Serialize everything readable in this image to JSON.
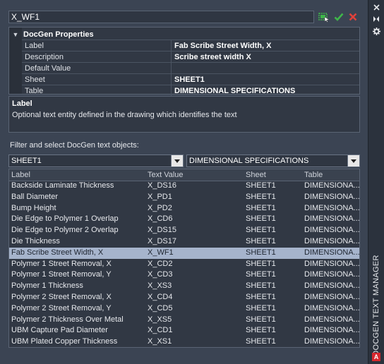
{
  "name_field": {
    "value": "X_WF1"
  },
  "toolbar": {
    "pick_icon": "select-object-icon",
    "accept_icon": "checkmark-icon",
    "cancel_icon": "close-x-icon"
  },
  "properties": {
    "category": "DocGen Properties",
    "rows": [
      {
        "key": "Label",
        "value": "Fab Scribe Street Width, X"
      },
      {
        "key": "Description",
        "value": "Scribe street width X"
      },
      {
        "key": "Default Value",
        "value": ""
      },
      {
        "key": "Sheet",
        "value": "SHEET1"
      },
      {
        "key": "Table",
        "value": "DIMENSIONAL SPECIFICATIONS"
      }
    ]
  },
  "description_panel": {
    "title": "Label",
    "text": "Optional text entity defined in the drawing which identifies the text"
  },
  "filter": {
    "label": "Filter and select DocGen text objects:",
    "sheet_value": "SHEET1",
    "table_value": "DIMENSIONAL SPECIFICATIONS"
  },
  "table": {
    "columns": [
      "Label",
      "Text Value",
      "Sheet",
      "Table"
    ],
    "selected_index": 6,
    "rows": [
      [
        "Backside Laminate Thickness",
        "X_DS16",
        "SHEET1",
        "DIMENSIONA..."
      ],
      [
        "Ball Diameter",
        "X_PD1",
        "SHEET1",
        "DIMENSIONA..."
      ],
      [
        "Bump Height",
        "X_PD2",
        "SHEET1",
        "DIMENSIONA..."
      ],
      [
        "Die Edge to Polymer 1 Overlap",
        "X_CD6",
        "SHEET1",
        "DIMENSIONA..."
      ],
      [
        "Die Edge to Polymer 2 Overlap",
        "X_DS15",
        "SHEET1",
        "DIMENSIONA..."
      ],
      [
        "Die Thickness",
        "X_DS17",
        "SHEET1",
        "DIMENSIONA..."
      ],
      [
        "Fab Scribe Street Width, X",
        "X_WF1",
        "SHEET1",
        "DIMENSIONA..."
      ],
      [
        "Polymer 1 Street Removal, X",
        "X_CD2",
        "SHEET1",
        "DIMENSIONA..."
      ],
      [
        "Polymer 1 Street Removal, Y",
        "X_CD3",
        "SHEET1",
        "DIMENSIONA..."
      ],
      [
        "Polymer 1 Thickness",
        "X_XS3",
        "SHEET1",
        "DIMENSIONA..."
      ],
      [
        "Polymer 2 Street Removal, X",
        "X_CD4",
        "SHEET1",
        "DIMENSIONA..."
      ],
      [
        "Polymer 2 Street Removal, Y",
        "X_CD5",
        "SHEET1",
        "DIMENSIONA..."
      ],
      [
        "Polymer 2 Thickness Over Metal",
        "X_XS5",
        "SHEET1",
        "DIMENSIONA..."
      ],
      [
        "UBM Capture Pad Diameter",
        "X_CD1",
        "SHEET1",
        "DIMENSIONA..."
      ],
      [
        "UBM Plated Copper Thickness",
        "X_XS1",
        "SHEET1",
        "DIMENSIONA..."
      ]
    ]
  },
  "sidebar": {
    "title": "DOCGEN TEXT MANAGER",
    "close_icon": "close-icon",
    "pin_icon": "auto-hide-icon",
    "settings_icon": "gear-icon",
    "logo_text": "A"
  },
  "colors": {
    "background": "#3b4453",
    "selected_row": "#a6b4cc",
    "accept_green": "#3fb64a",
    "cancel_red": "#e0413a"
  }
}
